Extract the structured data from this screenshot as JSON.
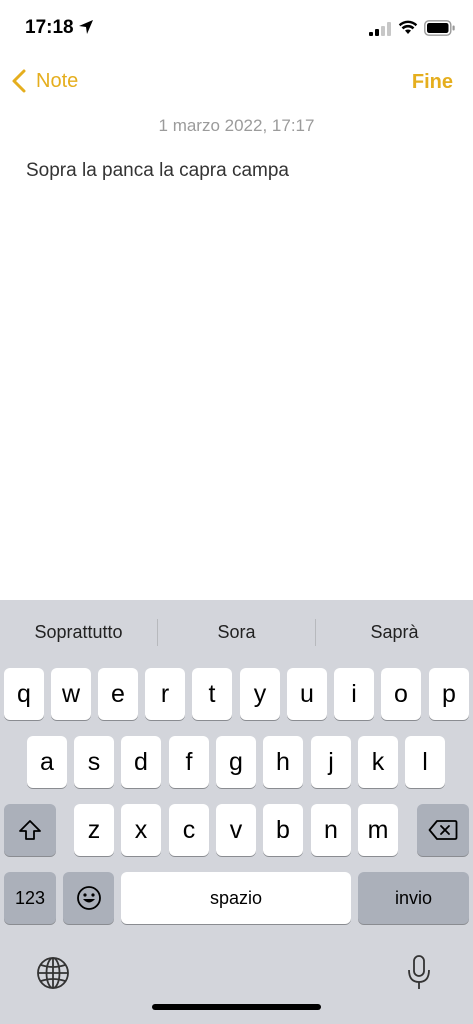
{
  "status": {
    "time": "17:18"
  },
  "nav": {
    "back_label": "Note",
    "done_label": "Fine"
  },
  "note": {
    "date": "1 marzo 2022, 17:17",
    "text": "Sopra la panca la capra campa"
  },
  "keyboard": {
    "suggestions": [
      "Soprattutto",
      "Sora",
      "Saprà"
    ],
    "row1": [
      "q",
      "w",
      "e",
      "r",
      "t",
      "y",
      "u",
      "i",
      "o",
      "p"
    ],
    "row2": [
      "a",
      "s",
      "d",
      "f",
      "g",
      "h",
      "j",
      "k",
      "l"
    ],
    "row3": [
      "z",
      "x",
      "c",
      "v",
      "b",
      "n",
      "m"
    ],
    "numbers_label": "123",
    "space_label": "spazio",
    "return_label": "invio"
  },
  "colors": {
    "accent": "#E5AE1E",
    "keyboard_bg": "#D3D5DB",
    "special_key": "#ABB0BA"
  }
}
